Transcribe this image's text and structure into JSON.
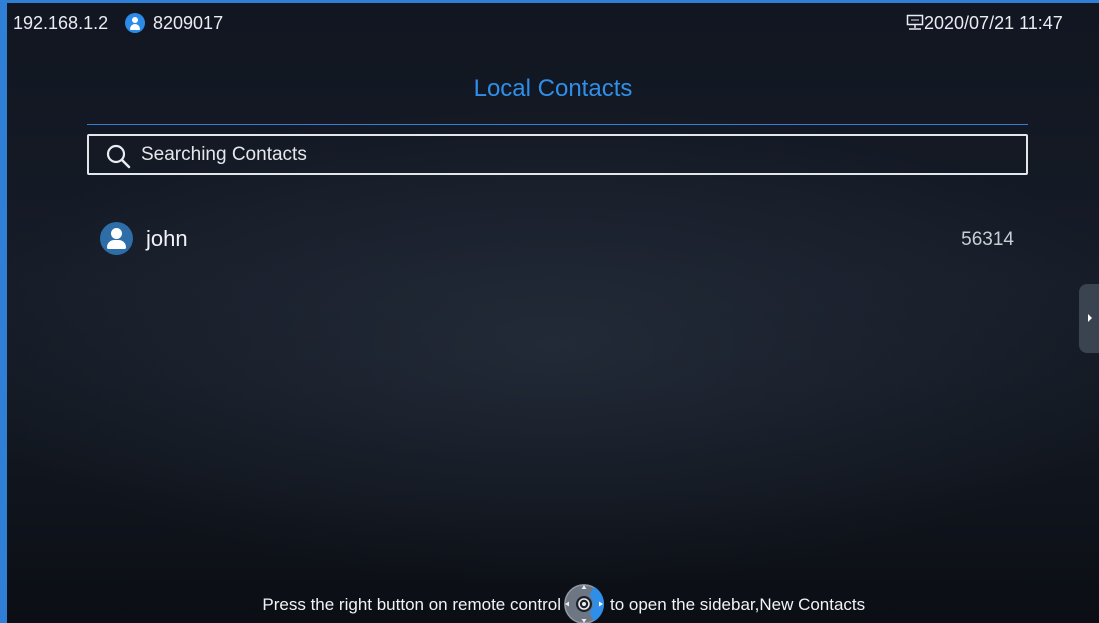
{
  "statusbar": {
    "ip": "192.168.1.2",
    "account_icon": "account-icon",
    "account": "8209017",
    "network_icon": "network-icon",
    "datetime": "2020/07/21 11:47"
  },
  "page": {
    "title": "Local Contacts"
  },
  "search": {
    "icon": "search-icon",
    "placeholder": "Searching Contacts",
    "value": ""
  },
  "contacts": [
    {
      "name": "john",
      "number": "56314",
      "icon": "person-icon"
    }
  ],
  "sidebar": {
    "icon": "chevron-right-icon"
  },
  "hint": {
    "before": "Press the right button on remote control",
    "icon": "remote-dpad-icon",
    "after": "to open the sidebar,New Contacts"
  },
  "colors": {
    "accent": "#2f8fe8",
    "frame": "#2f7fd6",
    "background": "#141a24",
    "avatar": "#2e6ea8"
  }
}
